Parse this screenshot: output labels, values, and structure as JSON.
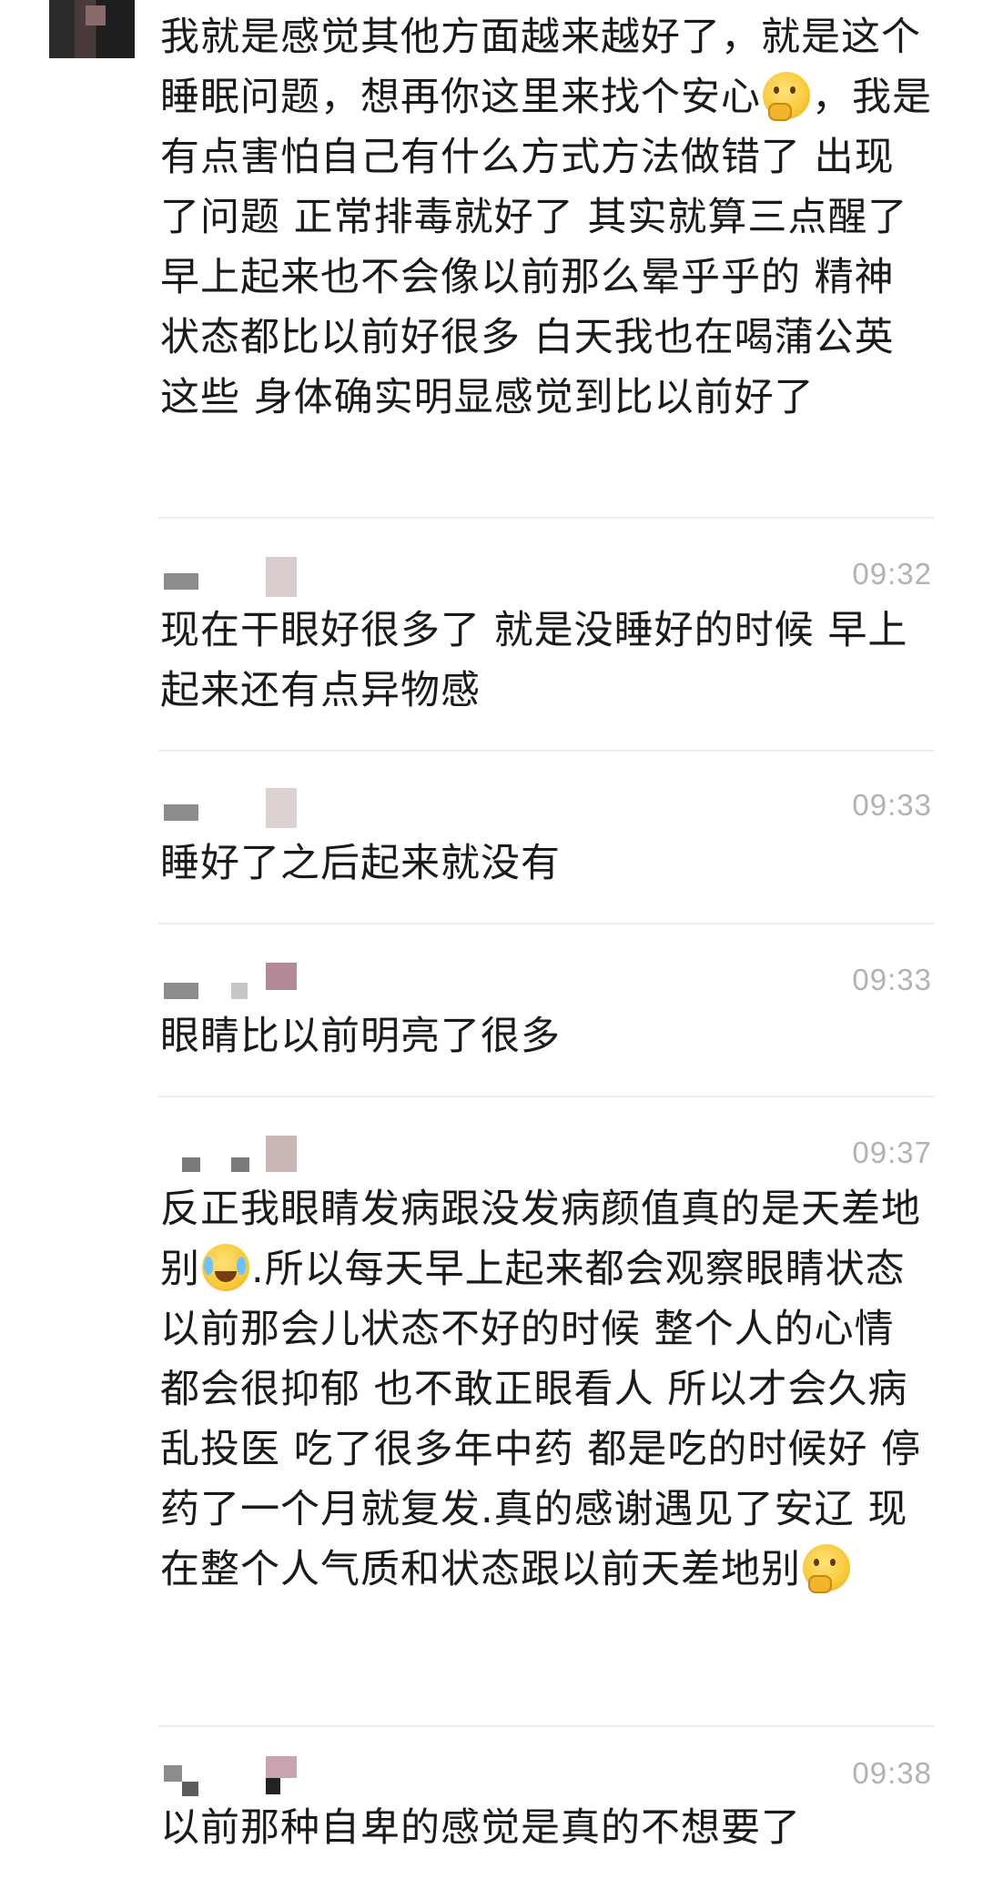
{
  "messages": [
    {
      "text_parts": [
        "我就是感觉其他方面越来越好了，就是这个睡眠问题，想再你这里来找个安心",
        "，我是有点害怕自己有什么方式方法做错了 出现了问题 正常排毒就好了 其实就算三点醒了 早上起来也不会像以前那么晕乎乎的 精神状态都比以前好很多 白天我也在喝蒲公英这些 身体确实明显感觉到比以前好了"
      ],
      "emojis": [
        "thinking-face-emoji"
      ]
    },
    {
      "time": "09:32",
      "text": "现在干眼好很多了 就是没睡好的时候 早上起来还有点异物感"
    },
    {
      "time": "09:33",
      "text": "睡好了之后起来就没有"
    },
    {
      "time": "09:33",
      "text": "眼睛比以前明亮了很多"
    },
    {
      "time": "09:37",
      "text_parts": [
        "反正我眼睛发病跟没发病颜值真的是天差地别",
        ".所以每天早上起来都会观察眼睛状态 以前那会儿状态不好的时候 整个人的心情都会很抑郁 也不敢正眼看人 所以才会久病乱投医 吃了很多年中药 都是吃的时候好 停药了一个月就复发.真的感谢遇见了安辽 现在整个人气质和状态跟以前天差地别"
      ],
      "emojis": [
        "crying-laughing-emoji",
        "thinking-face-emoji"
      ]
    },
    {
      "time": "09:38",
      "text": "以前那种自卑的感觉是真的不想要了"
    }
  ],
  "colors": {
    "text": "#1a1a1a",
    "time": "#b2b2b2",
    "divider": "#ececec",
    "background": "#ffffff"
  }
}
